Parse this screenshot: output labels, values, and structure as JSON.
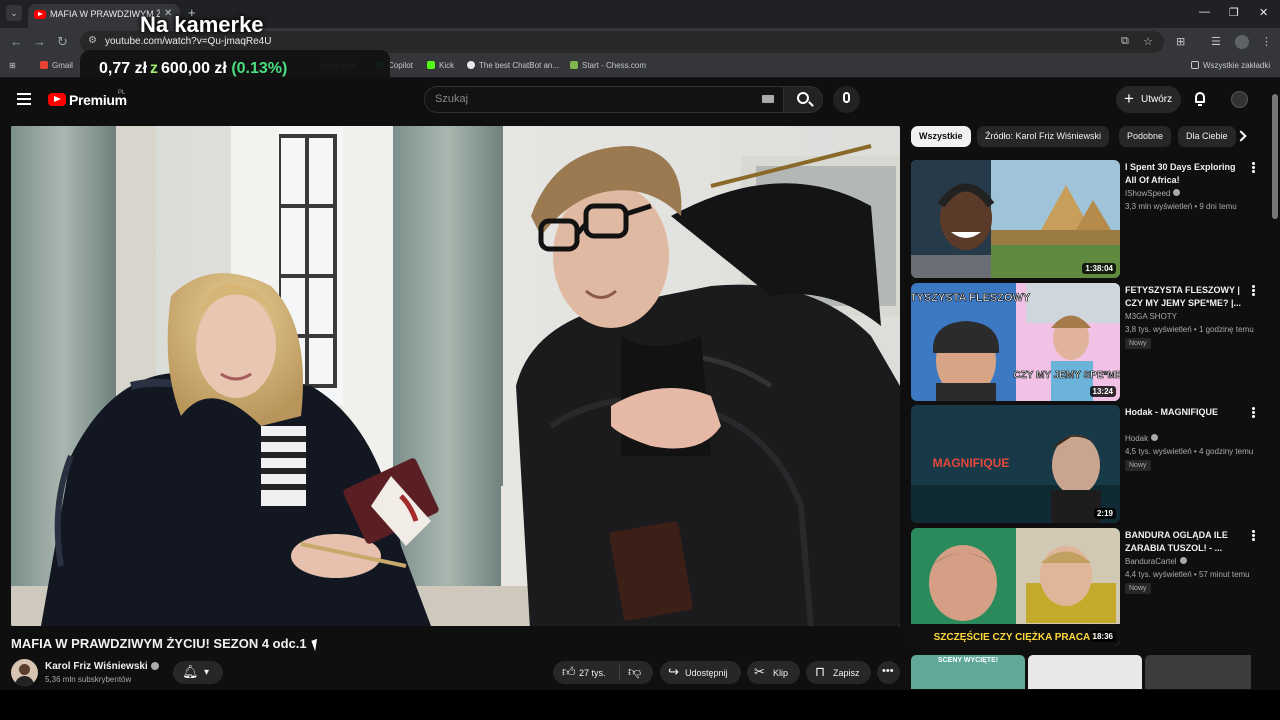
{
  "browser": {
    "tab_title": "MAFIA W PRAWDZIWYM ŻYCIU",
    "tab_close": "✕",
    "new_tab": "+",
    "url": "youtube.com/watch?v=Qu-jmaqRe4U",
    "bookmarks": [
      {
        "label": "Gmail",
        "color": "#ea4335"
      },
      {
        "label": "geoguessr",
        "color": "#7b61ff"
      },
      {
        "label": "Copilot",
        "color": "#2a9d8f"
      },
      {
        "label": "Kick",
        "color": "#53fc18"
      },
      {
        "label": "The best ChatBot an...",
        "color": "#e8eaed"
      },
      {
        "label": "Start - Chess.com",
        "color": "#81b64c"
      }
    ],
    "all_bookmarks": "Wszystkie zakładki"
  },
  "overlay": {
    "camera_label": "Na kamerke",
    "amount": "0,77 zł",
    "of": "z",
    "goal": "600,00 zł",
    "percent": "(0.13%)"
  },
  "youtube": {
    "logo_text": "Premium",
    "country": "PL",
    "search_placeholder": "Szukaj",
    "create_label": "Utwórz"
  },
  "video": {
    "title": "MAFIA W PRAWDZIWYM ŻYCIU! SEZON 4 odc.1",
    "channel": "Karol Friz Wiśniewski",
    "subscribers": "5,36 mln subskrybentów",
    "likes": "27 tys.",
    "share": "Udostępnij",
    "clip": "Klip",
    "save": "Zapisz"
  },
  "chips": [
    "Wszystkie",
    "Źródło: Karol Friz Wiśniewski",
    "Podobne",
    "Dla Ciebie"
  ],
  "recommendations": [
    {
      "title": "I Spent 30 Days Exploring All Of Africa!",
      "channel": "IShowSpeed",
      "verified": true,
      "meta": "3,3 mln wyświetleń • 9 dni temu",
      "duration": "1:38:04",
      "badge": ""
    },
    {
      "title": "FETYSZYSTA FLESZOWY | CZY MY JEMY SPE*ME? |...",
      "channel": "M3GA SHOTY",
      "verified": false,
      "meta": "3,8 tys. wyświetleń • 1 godzinę temu",
      "duration": "13:24",
      "badge": "Nowy"
    },
    {
      "title": "Hodak - MAGNIFIQUE",
      "channel": "Hodak",
      "verified": true,
      "meta": "4,5 tys. wyświetleń • 4 godziny temu",
      "duration": "2:19",
      "badge": "Nowy"
    },
    {
      "title": "BANDURA OGLĄDA ILE ZARABIA TUSZOL! - ...",
      "channel": "BanduraCartel",
      "verified": true,
      "meta": "4,4 tys. wyświetleń • 57 minut temu",
      "duration": "18:36",
      "badge": "Nowy"
    }
  ],
  "shorts": [
    {
      "text": "SCENY WYCIĘTE!"
    },
    {
      "text": ""
    },
    {
      "text": ""
    }
  ],
  "thumb_texts": {
    "fleszowy": "FETYSZYSTA FLESZOWY",
    "czy_my": "CZY MY JEMY SPE*ME?",
    "magnifique": "MAGNIFIQUE",
    "bandura_caption": "SZCZĘŚCIE CZY CIĘŻKA PRACA?"
  }
}
